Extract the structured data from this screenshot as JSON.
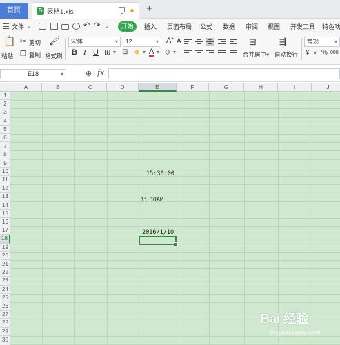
{
  "tabs": {
    "home_label": "首页",
    "file_name": "表格1.xls",
    "add_label": "+"
  },
  "menu": {
    "file_label": "文件",
    "start_label": "开始",
    "items": [
      "插入",
      "页面布局",
      "公式",
      "数据",
      "审阅",
      "视图",
      "开发工具",
      "特色功"
    ]
  },
  "toolbar": {
    "paste_label": "粘贴",
    "cut_label": "剪切",
    "copy_label": "复制",
    "format_painter_label": "格式刷",
    "font_name": "宋体",
    "font_size": "12",
    "merge_center_label": "合并居中",
    "wrap_text_label": "自动换行",
    "number_format": "常规",
    "currency_symbol": "¥",
    "percent_symbol": "%",
    "thousands_symbol": "000"
  },
  "formula_bar": {
    "name_box": "E18",
    "fx_label": "fx",
    "formula_value": ""
  },
  "sheet": {
    "active_cell": "E18",
    "columns": [
      "A",
      "B",
      "C",
      "D",
      "E",
      "F",
      "G",
      "H",
      "I",
      "J"
    ],
    "rows": [
      "1",
      "2",
      "3",
      "4",
      "5",
      "6",
      "7",
      "8",
      "9",
      "10",
      "11",
      "12",
      "13",
      "14",
      "15",
      "16",
      "17",
      "18",
      "19",
      "20",
      "21",
      "22",
      "23",
      "24",
      "25",
      "26",
      "27",
      "28",
      "29",
      "30"
    ],
    "cells": {
      "E10": "15:30:00",
      "E13": "3：30AM",
      "E17": "2016/1/10"
    }
  },
  "watermark": {
    "brand": "Bai 经验",
    "url": "jingyan.baidu.com"
  },
  "colors": {
    "sheet_background": "#cfe8cf",
    "selection": "#2f8f3a",
    "start_button": "#2fa84f",
    "home_tab": "#4a7ed6"
  }
}
